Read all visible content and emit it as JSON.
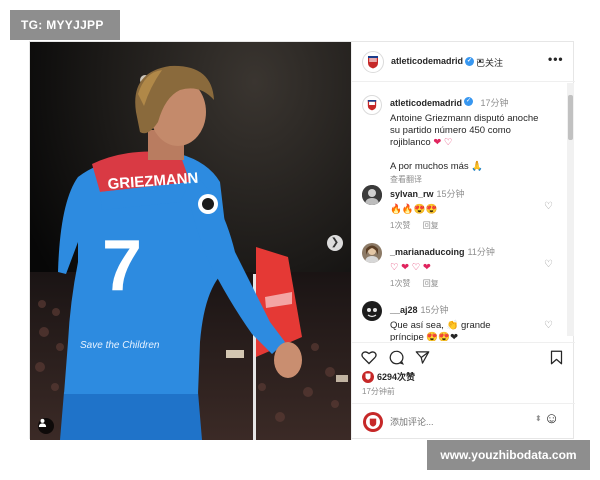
{
  "watermarks": {
    "top_left": "TG: MYYJJPP",
    "bottom_right": "www.youzhibodata.com"
  },
  "media": {
    "jersey_text": "GRIEZMANN",
    "jersey_number": "7",
    "sponsor_text": "Save the Children"
  },
  "header": {
    "username": "atleticodemadrid",
    "dot": "•",
    "follow_state": "已关注",
    "more": "•••"
  },
  "caption": {
    "username": "atleticodemadrid",
    "time": "17分钟",
    "line1": "Antoine Griezmann disputó anoche",
    "line2": "su partido número 450 como",
    "line3": "rojiblanco",
    "emojis": "❤ ♡",
    "line4": "A por muchos más 🙏",
    "translate": "查看翻译"
  },
  "comments": [
    {
      "username": "sylvan_rw",
      "time": "15分钟",
      "text": "🔥🔥😍😍",
      "likes": "1次赞",
      "reply": "回复"
    },
    {
      "username": "_marianaducoing",
      "time": "11分钟",
      "text": "♡ ❤ ♡ ❤",
      "likes": "1次赞",
      "reply": "回复"
    },
    {
      "username": "__aj28",
      "time": "15分钟",
      "text_line1": "Que así sea,",
      "text_emoji": "👏",
      "text_line1b": "grande",
      "text_line2": "príncipe 😍😍❤"
    }
  ],
  "post_actions": {
    "likes": "6294次赞",
    "time": "17分钟前"
  },
  "add_comment": {
    "placeholder": "添加评论...",
    "emoji": "☺"
  }
}
